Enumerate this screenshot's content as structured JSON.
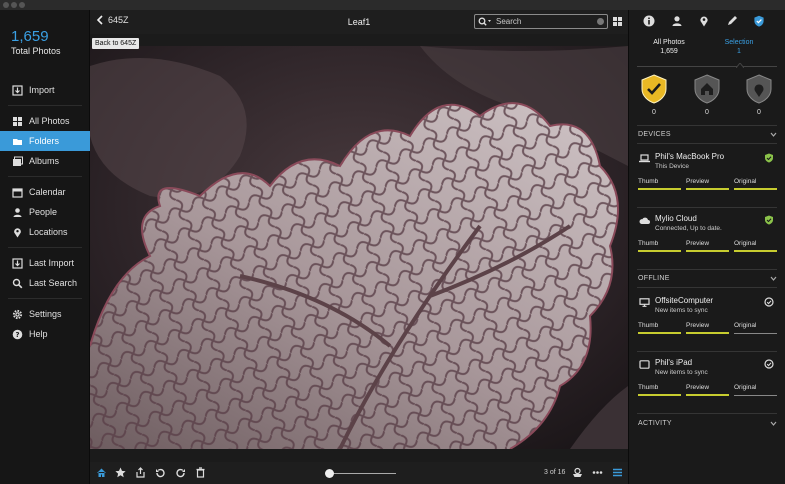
{
  "sidebar": {
    "total_count": "1,659",
    "total_label": "Total Photos",
    "items": [
      {
        "label": "Import",
        "icon": "import-icon"
      },
      {
        "label": "All Photos",
        "icon": "grid-icon"
      },
      {
        "label": "Folders",
        "icon": "folder-icon",
        "active": true
      },
      {
        "label": "Albums",
        "icon": "albums-icon"
      },
      {
        "label": "Calendar",
        "icon": "calendar-icon"
      },
      {
        "label": "People",
        "icon": "person-icon"
      },
      {
        "label": "Locations",
        "icon": "pin-icon"
      },
      {
        "label": "Last Import",
        "icon": "import-icon"
      },
      {
        "label": "Last Search",
        "icon": "search-icon"
      },
      {
        "label": "Settings",
        "icon": "gear-icon"
      },
      {
        "label": "Help",
        "icon": "help-icon"
      }
    ]
  },
  "topbar": {
    "back_label": "645Z",
    "title": "Leaf1",
    "search_placeholder": "Search"
  },
  "tooltip": "Back to 645Z",
  "bottombar": {
    "counter": "3 of 16",
    "zoom_fraction": 0.05
  },
  "right_panel": {
    "tabs": [
      {
        "label": "All Photos",
        "count": "1,659"
      },
      {
        "label": "Selection",
        "count": "1"
      }
    ],
    "protection_counts": [
      "0",
      "0",
      "0"
    ],
    "sections": {
      "devices": "DEVICES",
      "offline": "OFFLINE",
      "activity": "ACTIVITY"
    },
    "columns": [
      "Thumb",
      "Preview",
      "Original"
    ],
    "devices": [
      {
        "name": "Phil's MacBook Pro",
        "sub": "This Device"
      },
      {
        "name": "Mylio Cloud",
        "sub": "Connected, Up to date."
      }
    ],
    "offline": [
      {
        "name": "OffsiteComputer",
        "sub": "New items to sync"
      },
      {
        "name": "Phil's iPad",
        "sub": "New items to sync"
      }
    ]
  },
  "colors": {
    "accent": "#3a9ad9",
    "shield_active": "#e9b824",
    "status_ok": "#8bc34a",
    "sync_bar": "#c7cc2f"
  }
}
